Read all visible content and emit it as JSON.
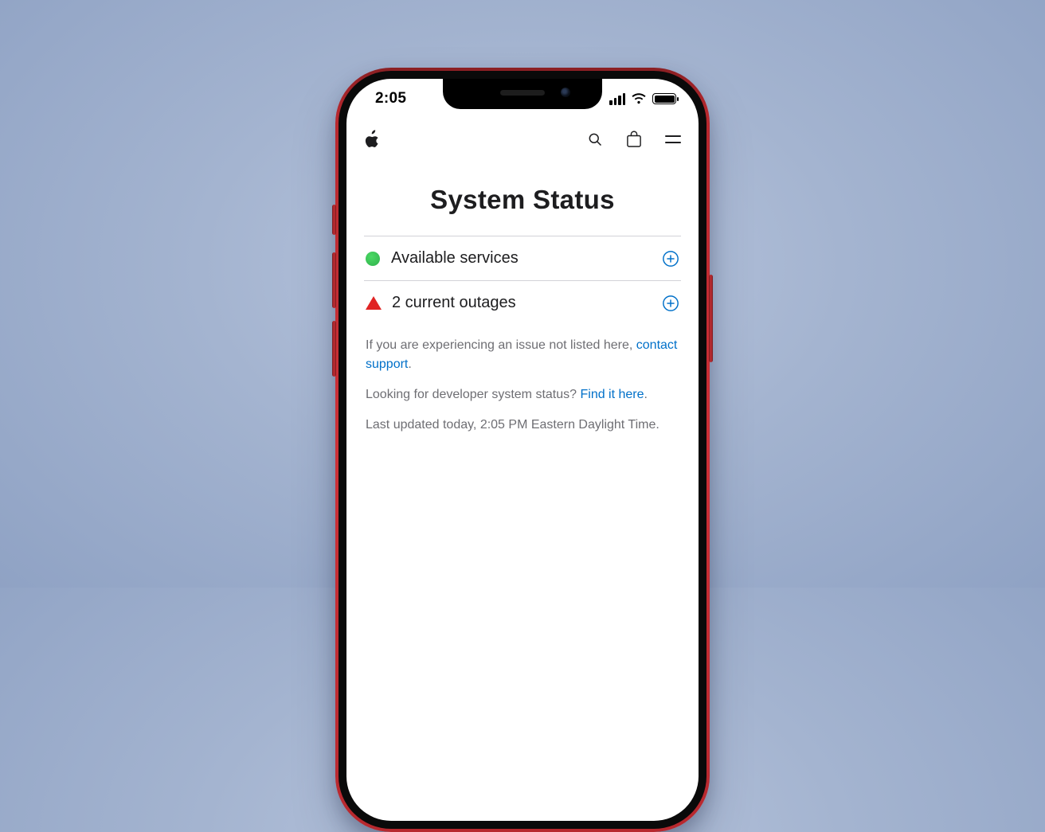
{
  "status_bar": {
    "time": "2:05"
  },
  "nav": {
    "logo": "apple-logo",
    "search": "search",
    "bag": "shopping-bag",
    "menu": "menu"
  },
  "page": {
    "title": "System Status"
  },
  "rows": {
    "available": {
      "label": "Available services"
    },
    "outages": {
      "label": "2 current outages"
    }
  },
  "notes": {
    "p1_prefix": "If you are experiencing an issue not listed here, ",
    "p1_link": "contact support",
    "p1_suffix": ".",
    "p2_prefix": "Looking for developer system status? ",
    "p2_link": "Find it here",
    "p2_suffix": ".",
    "p3": "Last updated today, 2:05 PM Eastern Daylight Time."
  }
}
